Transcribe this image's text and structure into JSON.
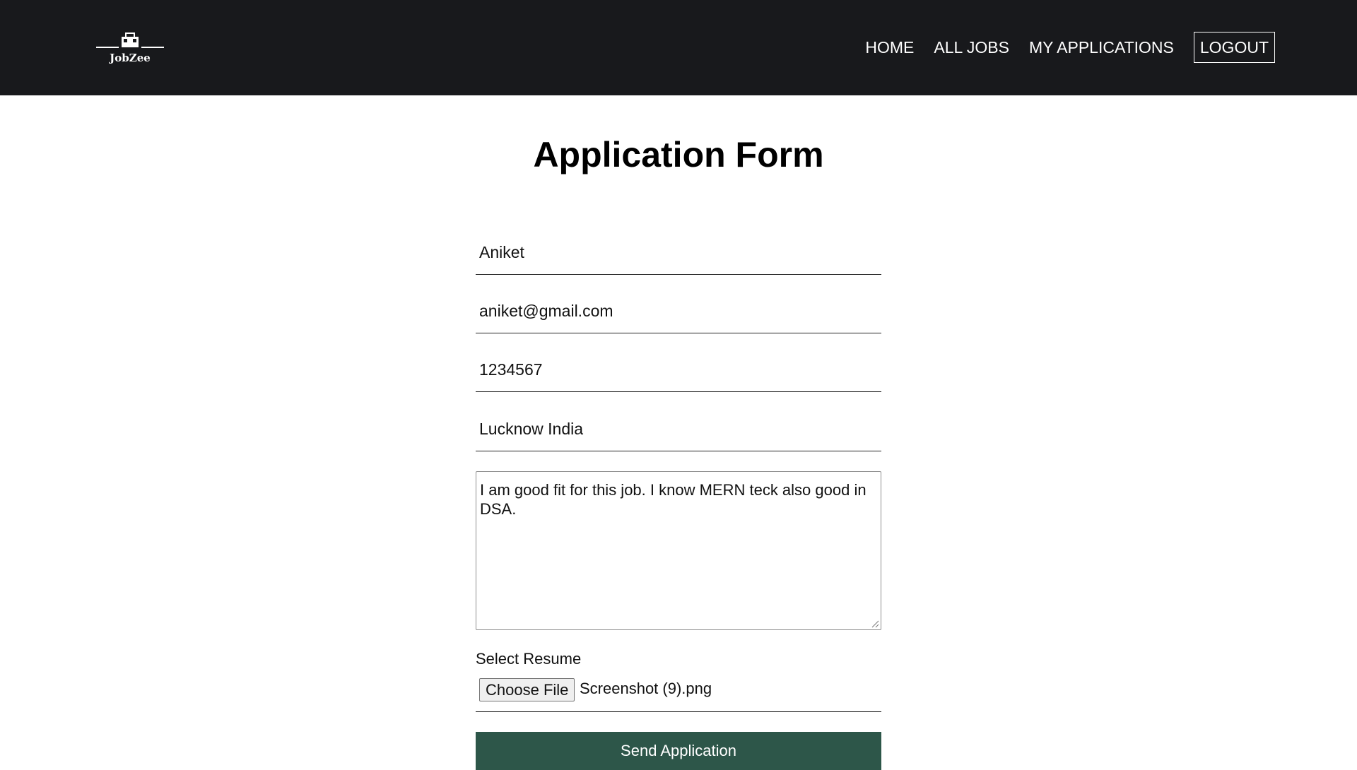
{
  "brand": {
    "name": "JobZee",
    "logo_icon": "briefcase-logo-icon"
  },
  "nav": {
    "items": [
      {
        "label": "HOME"
      },
      {
        "label": "ALL JOBS"
      },
      {
        "label": "MY APPLICATIONS"
      }
    ],
    "logout_label": "LOGOUT"
  },
  "page": {
    "title": "Application Form"
  },
  "form": {
    "name": "Aniket",
    "email": "aniket@gmail.com",
    "phone": "1234567",
    "address": "Lucknow India",
    "cover_letter": "I am good fit for this job. I know MERN teck also good in DSA.",
    "resume_label": "Select Resume",
    "choose_file_label": "Choose File",
    "file_name": "Screenshot (9).png",
    "submit_label": "Send Application"
  },
  "colors": {
    "navbar_bg": "#18191c",
    "button_bg": "#2d5649",
    "text": "#000000"
  }
}
